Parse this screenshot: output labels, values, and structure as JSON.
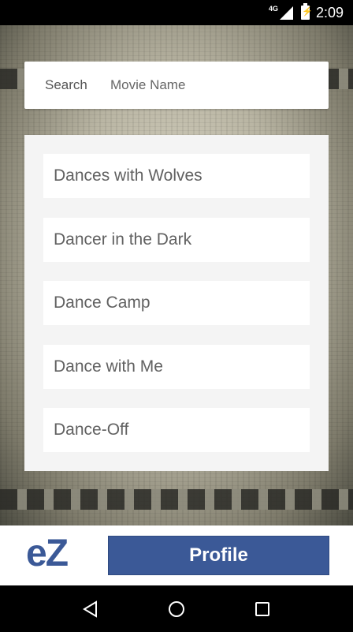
{
  "status_bar": {
    "network": "4G",
    "time": "2:09"
  },
  "search": {
    "label": "Search",
    "placeholder": "Movie Name",
    "value": ""
  },
  "results": [
    {
      "title": "Dances with Wolves"
    },
    {
      "title": "Dancer in the Dark"
    },
    {
      "title": "Dance Camp"
    },
    {
      "title": "Dance with Me"
    },
    {
      "title": "Dance-Off"
    }
  ],
  "bottom_bar": {
    "logo_text": "eZ",
    "profile_label": "Profile"
  },
  "colors": {
    "brand": "#3b5997",
    "panel": "#f4f4f4",
    "item_text": "#616161"
  },
  "nav": {
    "back_icon": "back-icon",
    "home_icon": "home-icon",
    "recents_icon": "recents-icon"
  }
}
